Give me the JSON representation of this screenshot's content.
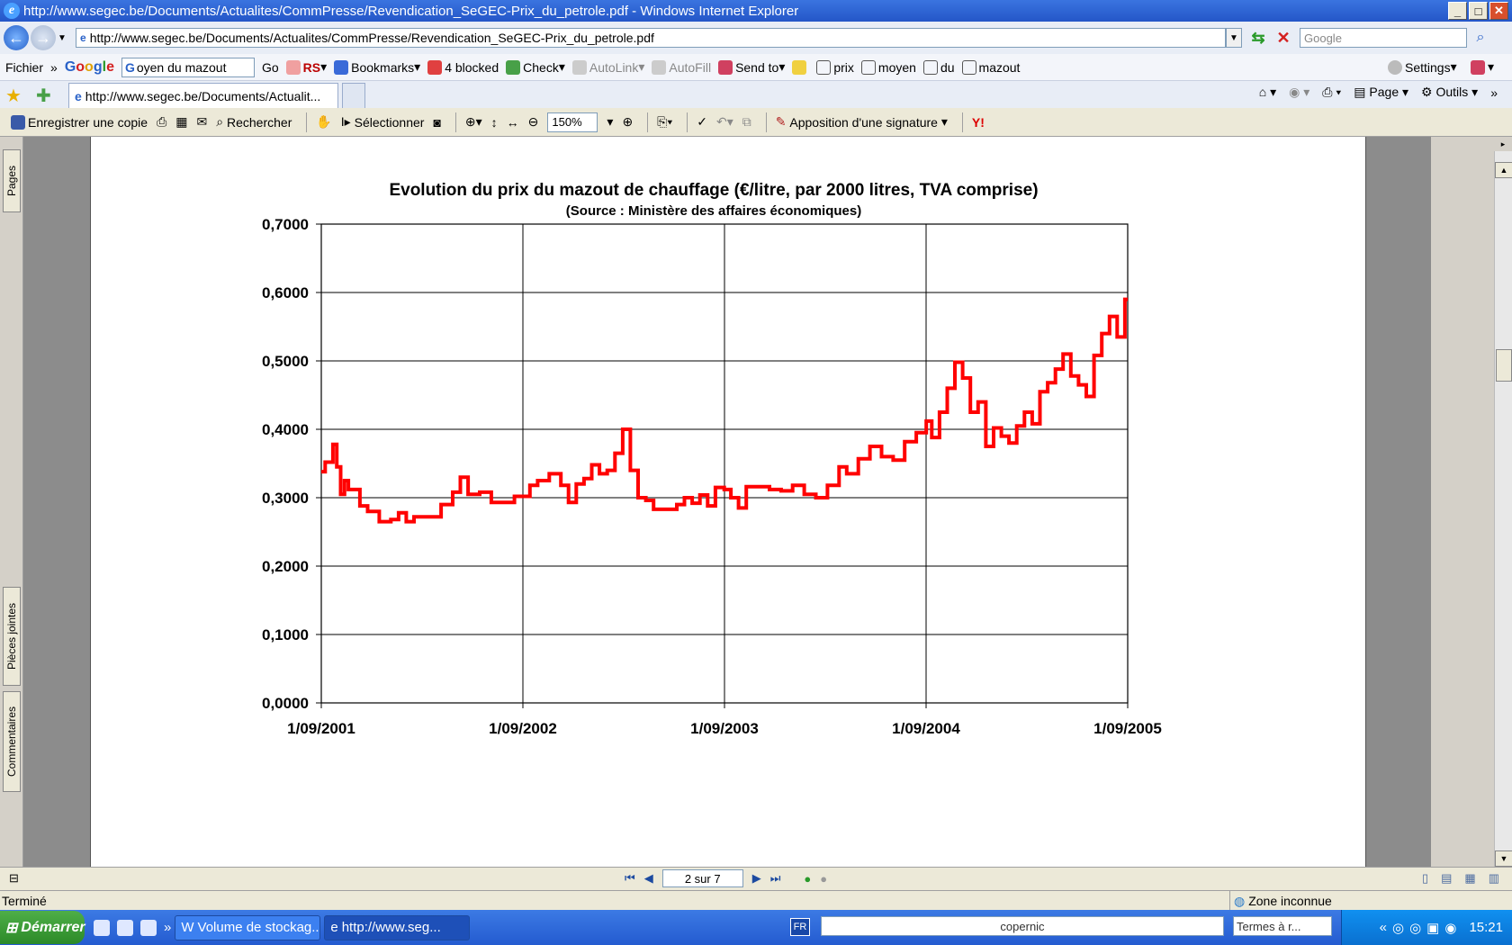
{
  "window": {
    "title": "http://www.segec.be/Documents/Actualites/CommPresse/Revendication_SeGEC-Prix_du_petrole.pdf - Windows Internet Explorer",
    "min": "_",
    "max": "□",
    "close": "✕"
  },
  "address": {
    "url": "http://www.segec.be/Documents/Actualites/CommPresse/Revendication_SeGEC-Prix_du_petrole.pdf",
    "search_placeholder": "Google"
  },
  "toolbar1": {
    "fichier": "Fichier",
    "google_query": "oyen du mazout",
    "go": "Go",
    "rs": "RS",
    "bookmarks": "Bookmarks",
    "blocked": "4 blocked",
    "check": "Check",
    "autolink": "AutoLink",
    "autofill": "AutoFill",
    "sendto": "Send to",
    "words": [
      "prix",
      "moyen",
      "du",
      "mazout"
    ],
    "settings": "Settings"
  },
  "tabs": {
    "active_tab": "http://www.segec.be/Documents/Actualit...",
    "page": "Page",
    "outils": "Outils"
  },
  "pdf_toolbar": {
    "save_copy": "Enregistrer une copie",
    "search": "Rechercher",
    "select": "Sélectionner",
    "zoom": "150%",
    "signature": "Apposition d'une signature"
  },
  "side_tabs": {
    "pages": "Pages",
    "attachments": "Pièces jointes",
    "comments": "Commentaires"
  },
  "page_nav": {
    "page_indicator": "2 sur 7"
  },
  "status": {
    "text": "Terminé",
    "zone": "Zone inconnue"
  },
  "taskbar": {
    "start": "Démarrer",
    "task1": "Volume de stockag...",
    "task2": "http://www.seg...",
    "lang": "FR",
    "copernic": "copernic",
    "termes": "Termes à r...",
    "clock": "15:21"
  },
  "colors": {
    "series": "#ff0000",
    "grid": "#000000"
  },
  "chart_data": {
    "type": "line",
    "title": "Evolution du prix du mazout de chauffage (€/litre, par 2000 litres, TVA comprise)",
    "subtitle": "(Source : Ministère des affaires économiques)",
    "x_tick_labels": [
      "1/09/2001",
      "1/09/2002",
      "1/09/2003",
      "1/09/2004",
      "1/09/2005"
    ],
    "y_tick_labels": [
      "0,0000",
      "0,1000",
      "0,2000",
      "0,3000",
      "0,4000",
      "0,5000",
      "0,6000",
      "0,7000"
    ],
    "xlim": [
      "2001-09-01",
      "2005-09-01"
    ],
    "ylim": [
      0,
      0.7
    ],
    "grid": true,
    "series": [
      {
        "x": [
          "2001-09-01",
          "2001-09-08",
          "2001-09-22",
          "2001-09-29",
          "2001-10-06",
          "2001-10-13",
          "2001-10-20",
          "2001-10-27",
          "2001-11-10",
          "2001-11-24",
          "2001-12-15",
          "2002-01-05",
          "2002-01-19",
          "2002-02-02",
          "2002-02-16",
          "2002-03-02",
          "2002-03-16",
          "2002-04-06",
          "2002-04-27",
          "2002-05-11",
          "2002-05-25",
          "2002-06-15",
          "2002-07-06",
          "2002-07-27",
          "2002-08-17",
          "2002-09-01",
          "2002-09-14",
          "2002-09-28",
          "2002-10-19",
          "2002-11-09",
          "2002-11-23",
          "2002-12-07",
          "2002-12-21",
          "2003-01-04",
          "2003-01-18",
          "2003-02-01",
          "2003-02-15",
          "2003-03-01",
          "2003-03-15",
          "2003-03-29",
          "2003-04-12",
          "2003-04-26",
          "2003-05-17",
          "2003-06-07",
          "2003-06-21",
          "2003-07-05",
          "2003-07-19",
          "2003-08-02",
          "2003-08-16",
          "2003-09-01",
          "2003-09-13",
          "2003-09-27",
          "2003-10-11",
          "2003-11-01",
          "2003-11-22",
          "2003-12-13",
          "2004-01-03",
          "2004-01-24",
          "2004-02-14",
          "2004-03-06",
          "2004-03-27",
          "2004-04-10",
          "2004-05-01",
          "2004-05-22",
          "2004-06-12",
          "2004-07-03",
          "2004-07-24",
          "2004-08-14",
          "2004-09-01",
          "2004-09-11",
          "2004-09-25",
          "2004-10-09",
          "2004-10-23",
          "2004-11-06",
          "2004-11-20",
          "2004-12-04",
          "2004-12-18",
          "2005-01-01",
          "2005-01-15",
          "2005-01-29",
          "2005-02-12",
          "2005-02-26",
          "2005-03-12",
          "2005-03-26",
          "2005-04-09",
          "2005-04-23",
          "2005-05-07",
          "2005-05-21",
          "2005-06-04",
          "2005-06-18",
          "2005-07-02",
          "2005-07-16",
          "2005-07-30",
          "2005-08-13",
          "2005-08-27"
        ],
        "y": [
          0.338,
          0.352,
          0.378,
          0.345,
          0.305,
          0.325,
          0.312,
          0.312,
          0.288,
          0.28,
          0.265,
          0.268,
          0.278,
          0.265,
          0.272,
          0.272,
          0.272,
          0.29,
          0.308,
          0.33,
          0.305,
          0.308,
          0.293,
          0.293,
          0.302,
          0.302,
          0.318,
          0.325,
          0.335,
          0.318,
          0.293,
          0.32,
          0.328,
          0.348,
          0.335,
          0.34,
          0.365,
          0.4,
          0.34,
          0.3,
          0.296,
          0.283,
          0.283,
          0.29,
          0.3,
          0.292,
          0.304,
          0.288,
          0.315,
          0.312,
          0.3,
          0.285,
          0.316,
          0.316,
          0.312,
          0.31,
          0.318,
          0.305,
          0.3,
          0.318,
          0.345,
          0.335,
          0.357,
          0.375,
          0.36,
          0.355,
          0.382,
          0.395,
          0.412,
          0.388,
          0.425,
          0.46,
          0.498,
          0.475,
          0.425,
          0.44,
          0.375,
          0.402,
          0.39,
          0.38,
          0.405,
          0.425,
          0.408,
          0.455,
          0.468,
          0.488,
          0.51,
          0.478,
          0.465,
          0.448,
          0.508,
          0.54,
          0.565,
          0.535,
          0.59
        ]
      }
    ]
  }
}
